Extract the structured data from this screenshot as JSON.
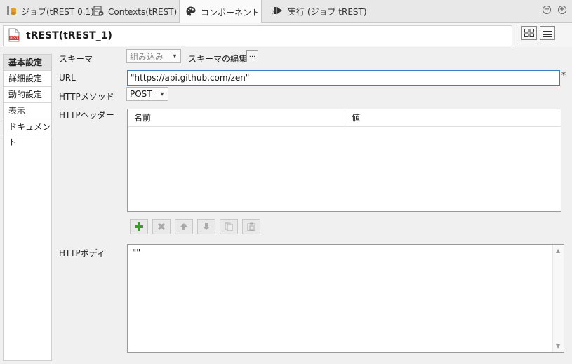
{
  "tabs": [
    {
      "label": "ジョブ(tREST 0.1)",
      "icon": "job-icon"
    },
    {
      "label": "Contexts(tREST)",
      "icon": "contexts-icon"
    },
    {
      "label": "コンポーネント",
      "icon": "palette-icon",
      "close": "×"
    },
    {
      "label": "実行 (ジョブ tREST)",
      "icon": "run-icon"
    }
  ],
  "window_controls": {
    "minimize": "−",
    "maximize": "+"
  },
  "header": {
    "title": "tREST(tREST_1)",
    "icon_text": "REST"
  },
  "nav": [
    "基本設定",
    "詳細設定",
    "動的設定",
    "表示",
    "ドキュメント"
  ],
  "form": {
    "schema_label": "スキーマ",
    "schema_value": "組み込み",
    "schema_edit_label": "スキーマの編集",
    "schema_edit_button": "...",
    "url_label": "URL",
    "url_value": "\"https://api.github.com/zen\"",
    "url_required": "*",
    "method_label": "HTTPメソッド",
    "method_value": "POST",
    "headers_label": "HTTPヘッダー",
    "headers_columns": [
      "名前",
      "値"
    ],
    "body_label": "HTTPボディ",
    "body_value": "\"\""
  },
  "colors": {
    "accent": "#3b7fc4",
    "add_green": "#3a9a2a",
    "rest_icon": "#d63a3a"
  }
}
